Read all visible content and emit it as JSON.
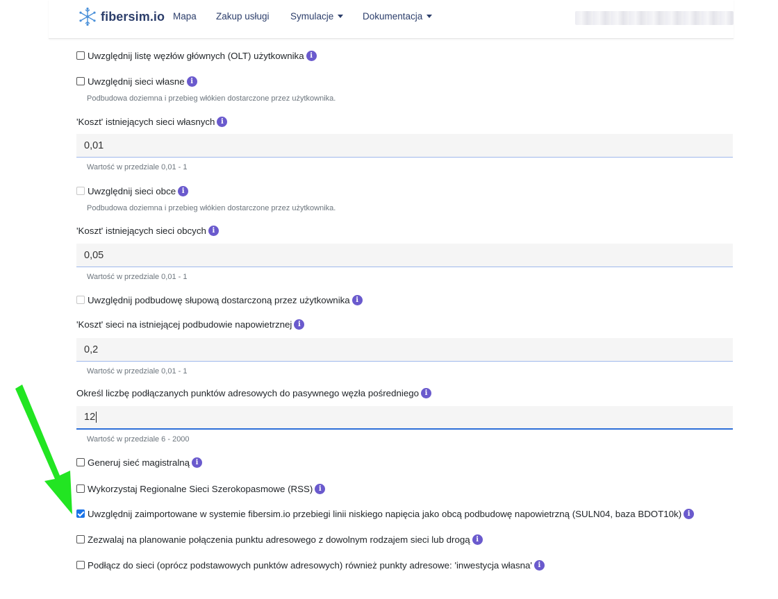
{
  "nav": {
    "brand": "fibersim.io",
    "links": [
      "Mapa",
      "Zakup usługi",
      "Symulacje",
      "Dokumentacja"
    ]
  },
  "colors": {
    "brand": "#2c3e6b",
    "info_icon": "#6a5acd",
    "checkbox_checked": "#1a73e8",
    "highlight_arrow": "#22e522"
  },
  "form": {
    "olt": {
      "label": "Uwzględnij listę węzłów głównych (OLT) użytkownika",
      "checked": false
    },
    "own_networks": {
      "label": "Uwzględnij sieci własne",
      "checked": false,
      "help": "Podbudowa doziemna i przebieg włókien dostarczone przez użytkownika."
    },
    "own_cost": {
      "label": "'Koszt' istniejących sieci własnych",
      "value": "0,01",
      "help": "Wartość w przedziale 0,01 - 1"
    },
    "foreign_networks": {
      "label": "Uwzględnij sieci obce",
      "checked": false,
      "disabled": true,
      "help": "Podbudowa doziemna i przebieg włókien dostarczone przez użytkownika."
    },
    "foreign_cost": {
      "label": "'Koszt' istniejących sieci obcych",
      "value": "0,05",
      "help": "Wartość w przedziale 0,01 - 1"
    },
    "poles": {
      "label": "Uwzględnij podbudowę słupową dostarczoną przez użytkownika",
      "checked": false,
      "disabled": true
    },
    "aerial_cost": {
      "label": "'Koszt' sieci na istniejącej podbudowie napowietrznej",
      "value": "0,2",
      "help": "Wartość w przedziale 0,01 - 1"
    },
    "address_points": {
      "label": "Określ liczbę podłączanych punktów adresowych do pasywnego węzła pośredniego",
      "value": "12",
      "help": "Wartość w przedziale 6 - 2000"
    },
    "backbone": {
      "label": "Generuj sieć magistralną",
      "checked": false
    },
    "rss": {
      "label": "Wykorzystaj Regionalne Sieci Szerokopasmowe (RSS)",
      "checked": false
    },
    "low_voltage": {
      "label": "Uwzględnij zaimportowane w systemie fibersim.io przebiegi linii niskiego napięcia jako obcą podbudowę napowietrzną (SULN04, baza BDOT10k)",
      "checked": true
    },
    "any_route": {
      "label": "Zezwalaj na planowanie połączenia punktu adresowego z dowolnym rodzajem sieci lub drogą",
      "checked": false
    },
    "own_investment": {
      "label": "Podłącz do sieci (oprócz podstawowych punktów adresowych) również punkty adresowe: 'inwestycja własna'",
      "checked": false
    }
  }
}
